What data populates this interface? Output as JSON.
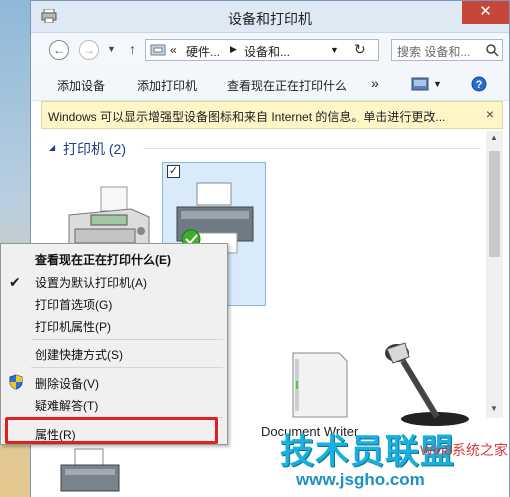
{
  "window": {
    "title": "设备和打印机"
  },
  "nav": {
    "path_prefix": "«",
    "crumb1": "硬件...",
    "crumb2": "设备和...",
    "search_placeholder": "搜索 设备和..."
  },
  "cmdbar": {
    "add_device": "添加设备",
    "add_printer": "添加打印机",
    "see_printing": "查看现在正在打印什么",
    "more": "»"
  },
  "infobar": {
    "text": "Windows 可以显示增强型设备图标和来自 Internet 的信息。单击进行更改...",
    "close": "×"
  },
  "content": {
    "group_printers": "打印机 (2)",
    "document_writer": "Document Writer"
  },
  "context_menu": {
    "items": [
      {
        "label": "查看现在正在打印什么(E)"
      },
      {
        "label": "设置为默认打印机(A)"
      },
      {
        "label": "打印首选项(G)"
      },
      {
        "label": "打印机属性(P)"
      },
      {
        "label": "创建快捷方式(S)"
      },
      {
        "label": "删除设备(V)"
      },
      {
        "label": "疑难解答(T)"
      },
      {
        "label": "属性(R)"
      }
    ],
    "checkmark": "✔"
  },
  "watermark": {
    "brand": "技术员联盟",
    "small": "Win8系统之家",
    "url": "www.jsgho.com"
  },
  "colors": {
    "highlight": "#e11f1f",
    "close": "#c7463a",
    "infobar": "#fff6c8"
  }
}
